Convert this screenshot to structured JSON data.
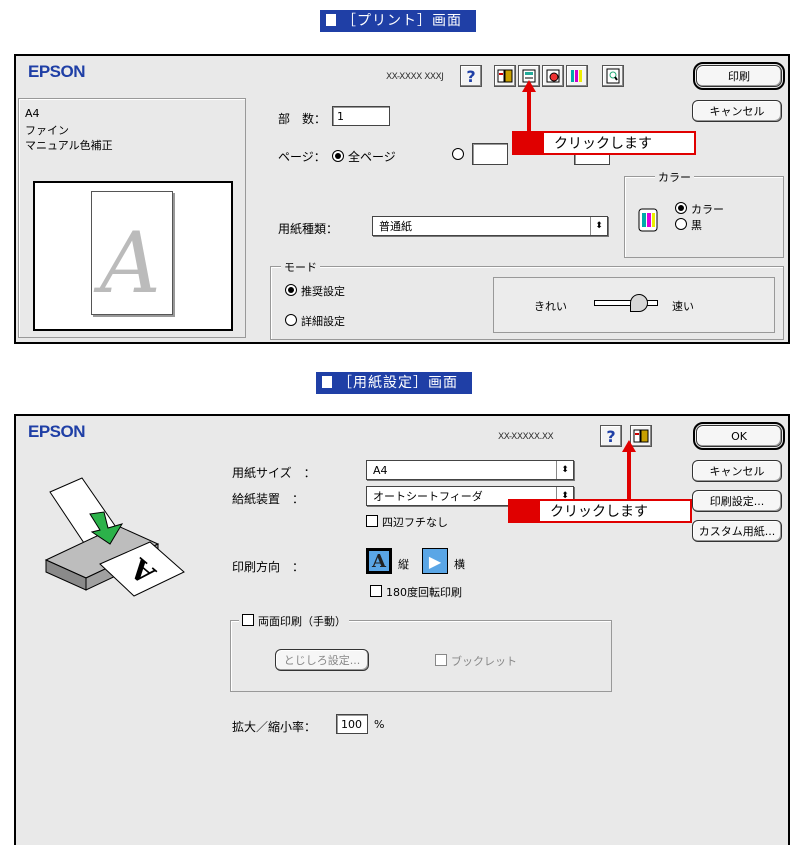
{
  "top_banner": "［プリント］画面",
  "print_dialog": {
    "brand": "EPSON",
    "model": "XX-XXXX XXXJ",
    "help_icon": "question-icon",
    "print_button": "印刷",
    "cancel_button": "キャンセル",
    "summary": [
      "A4",
      "ファイン",
      "マニュアル色補正"
    ],
    "preview_letter": "A",
    "copies_label": "部　数：",
    "copies_value": "1",
    "pages_label": "ページ：",
    "pages_all": "全ページ",
    "media_label": "用紙種類：",
    "media_value": "普通紙",
    "color_group": "カラー",
    "color_option": "カラー",
    "black_option": "黒",
    "mode_group": "モード",
    "mode_recommended": "推奨設定",
    "mode_detail": "詳細設定",
    "quality_left": "きれい",
    "quality_right": "速い"
  },
  "callout_text": "クリックします",
  "bottom_banner": "［用紙設定］画面",
  "page_setup_dialog": {
    "brand": "EPSON",
    "model": "XX-XXXXX.XX",
    "ok_button": "OK",
    "cancel_button": "キャンセル",
    "print_settings_button": "印刷設定...",
    "custom_paper_button": "カスタム用紙...",
    "paper_size_label": "用紙サイズ　：",
    "paper_size_value": "A4",
    "feeder_label": "給紙装置　：",
    "feeder_value": "オートシートフィーダ",
    "borderless": "四辺フチなし",
    "orientation_label": "印刷方向　：",
    "portrait": "縦",
    "landscape": "横",
    "rotate180": "180度回転印刷",
    "duplex_group": "両面印刷（手動）",
    "binding_button": "とじしろ設定...",
    "booklet": "ブックレット",
    "scale_label": "拡大／縮小率：",
    "scale_value": "100",
    "scale_unit": "%"
  }
}
